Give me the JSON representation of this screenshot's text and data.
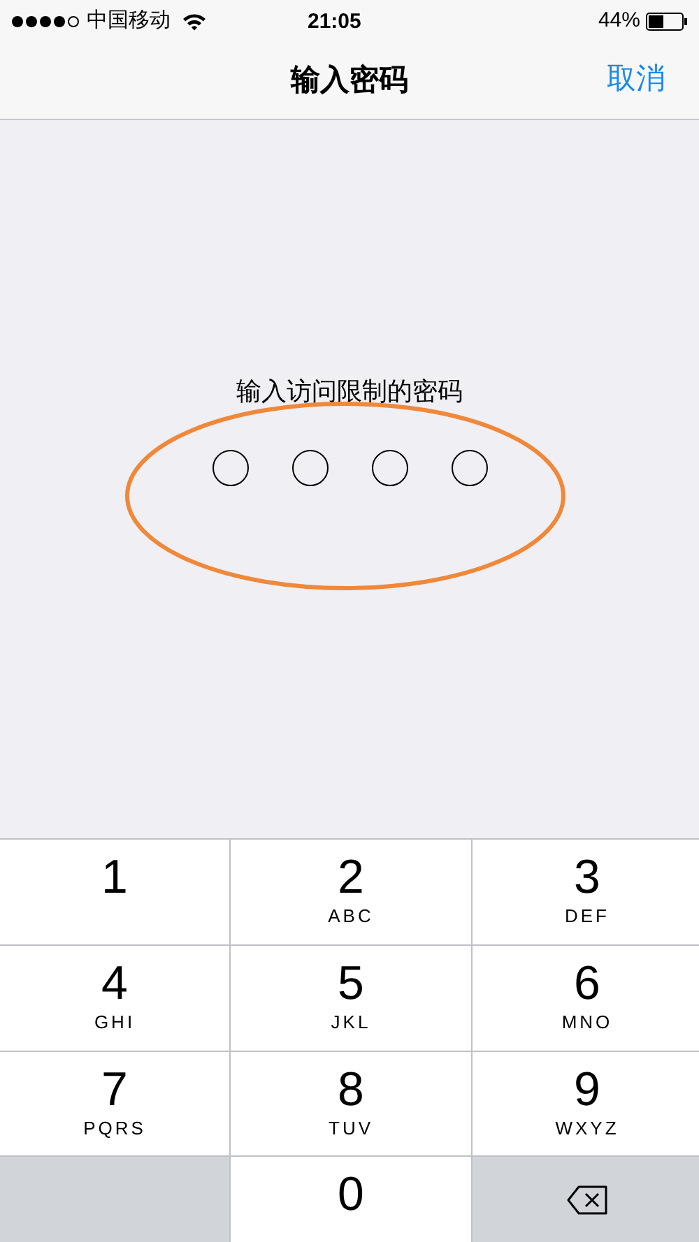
{
  "status_bar": {
    "carrier": "中国移动",
    "time": "21:05",
    "battery": "44%"
  },
  "nav": {
    "title": "输入密码",
    "cancel": "取消"
  },
  "prompt": "输入访问限制的密码",
  "passcode_dots": [
    {
      "filled": false
    },
    {
      "filled": false
    },
    {
      "filled": false
    },
    {
      "filled": false
    }
  ],
  "keypad": [
    {
      "kind": "digit",
      "digit": "1"
    },
    {
      "kind": "digit",
      "digit": "2",
      "letters": "ABC"
    },
    {
      "kind": "digit",
      "digit": "3",
      "letters": "DEF"
    },
    {
      "kind": "digit",
      "digit": "4",
      "letters": "GHI"
    },
    {
      "kind": "digit",
      "digit": "5",
      "letters": "JKL"
    },
    {
      "kind": "digit",
      "digit": "6",
      "letters": "MNO"
    },
    {
      "kind": "digit",
      "digit": "7",
      "letters": "PQRS"
    },
    {
      "kind": "digit",
      "digit": "8",
      "letters": "TUV"
    },
    {
      "kind": "digit",
      "digit": "9",
      "letters": "WXYZ"
    },
    {
      "kind": "blank"
    },
    {
      "kind": "digit",
      "digit": "0"
    },
    {
      "kind": "delete"
    }
  ]
}
